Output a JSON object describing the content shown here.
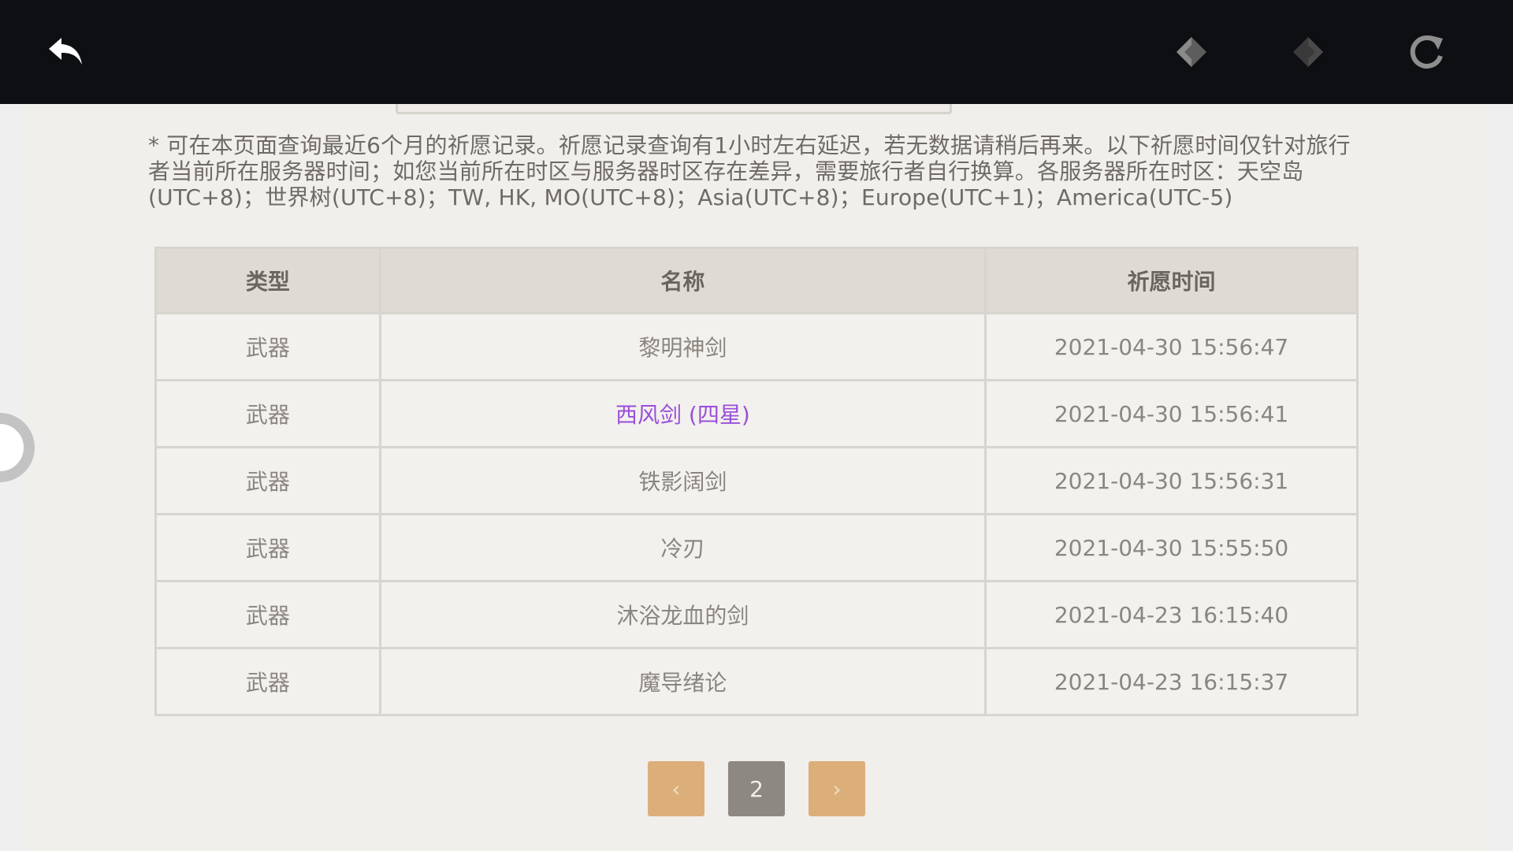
{
  "toolbar": {
    "back_icon": "back-arrow-icon",
    "nav_back_icon": "diamond-left-icon",
    "nav_forward_icon": "diamond-right-icon",
    "refresh_icon": "refresh-icon"
  },
  "notice": "* 可在本页面查询最近6个月的祈愿记录。祈愿记录查询有1小时左右延迟，若无数据请稍后再来。以下祈愿时间仅针对旅行者当前所在服务器时间；如您当前所在时区与服务器时区存在差异，需要旅行者自行换算。各服务器所在时区：天空岛(UTC+8)；世界树(UTC+8)；TW, HK, MO(UTC+8)；Asia(UTC+8)；Europe(UTC+1)；America(UTC-5)",
  "table": {
    "headers": [
      "类型",
      "名称",
      "祈愿时间"
    ],
    "rows": [
      {
        "type": "武器",
        "name": "黎明神剑",
        "time": "2021-04-30 15:56:47"
      },
      {
        "type": "武器",
        "name": "西风剑 (四星)",
        "time": "2021-04-30 15:56:41"
      },
      {
        "type": "武器",
        "name": "铁影阔剑",
        "time": "2021-04-30 15:56:31"
      },
      {
        "type": "武器",
        "name": "冷刃",
        "time": "2021-04-30 15:55:50"
      },
      {
        "type": "武器",
        "name": "沐浴龙血的剑",
        "time": "2021-04-23 16:15:40"
      },
      {
        "type": "武器",
        "name": "魔导绪论",
        "time": "2021-04-23 16:15:37"
      }
    ]
  },
  "pager": {
    "prev_label": "‹",
    "current_page": "2",
    "next_label": "›"
  },
  "colors": {
    "topbar": "#0d0f12",
    "four_star": "#9a4fdb",
    "pager_arrow": "#dcaf7a",
    "pager_current": "#8d8882"
  }
}
